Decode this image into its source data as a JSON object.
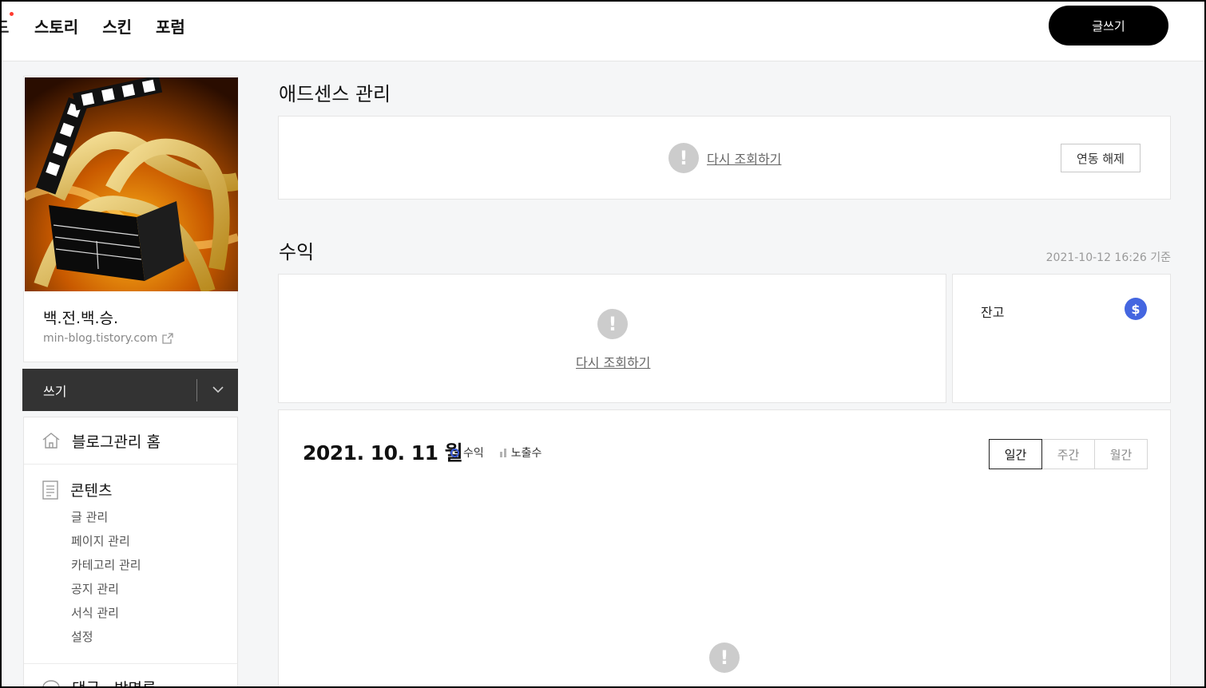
{
  "nav": {
    "partial_item": "드",
    "items": [
      "스토리",
      "스킨",
      "포럼"
    ],
    "write_button": "글쓰기"
  },
  "profile": {
    "blog_name": "백.전.백.승.",
    "blog_url": "min-blog.tistory.com"
  },
  "write_bar": {
    "label": "쓰기"
  },
  "menu": {
    "home": "블로그관리 홈",
    "contents": {
      "title": "콘텐츠",
      "items": [
        "글 관리",
        "페이지 관리",
        "카테고리 관리",
        "공지 관리",
        "서식 관리",
        "설정"
      ]
    },
    "next_section": "댓글 · 방명록"
  },
  "adsense": {
    "title": "애드센스 관리",
    "retry_link": "다시 조회하기",
    "unlink_button": "연동 해제"
  },
  "revenue": {
    "title": "수익",
    "timestamp": "2021-10-12 16:26 기준",
    "retry_link": "다시 조회하기",
    "balance_label": "잔고"
  },
  "chart_panel": {
    "date_title": "2021. 10. 11 월",
    "legend_revenue": "수익",
    "legend_impressions": "노출수",
    "tabs": [
      "일간",
      "주간",
      "월간"
    ],
    "active_tab": "일간"
  },
  "colors": {
    "accent_blue": "#3d5cd9",
    "dark": "#333333",
    "warn_gray": "#cccccc"
  }
}
